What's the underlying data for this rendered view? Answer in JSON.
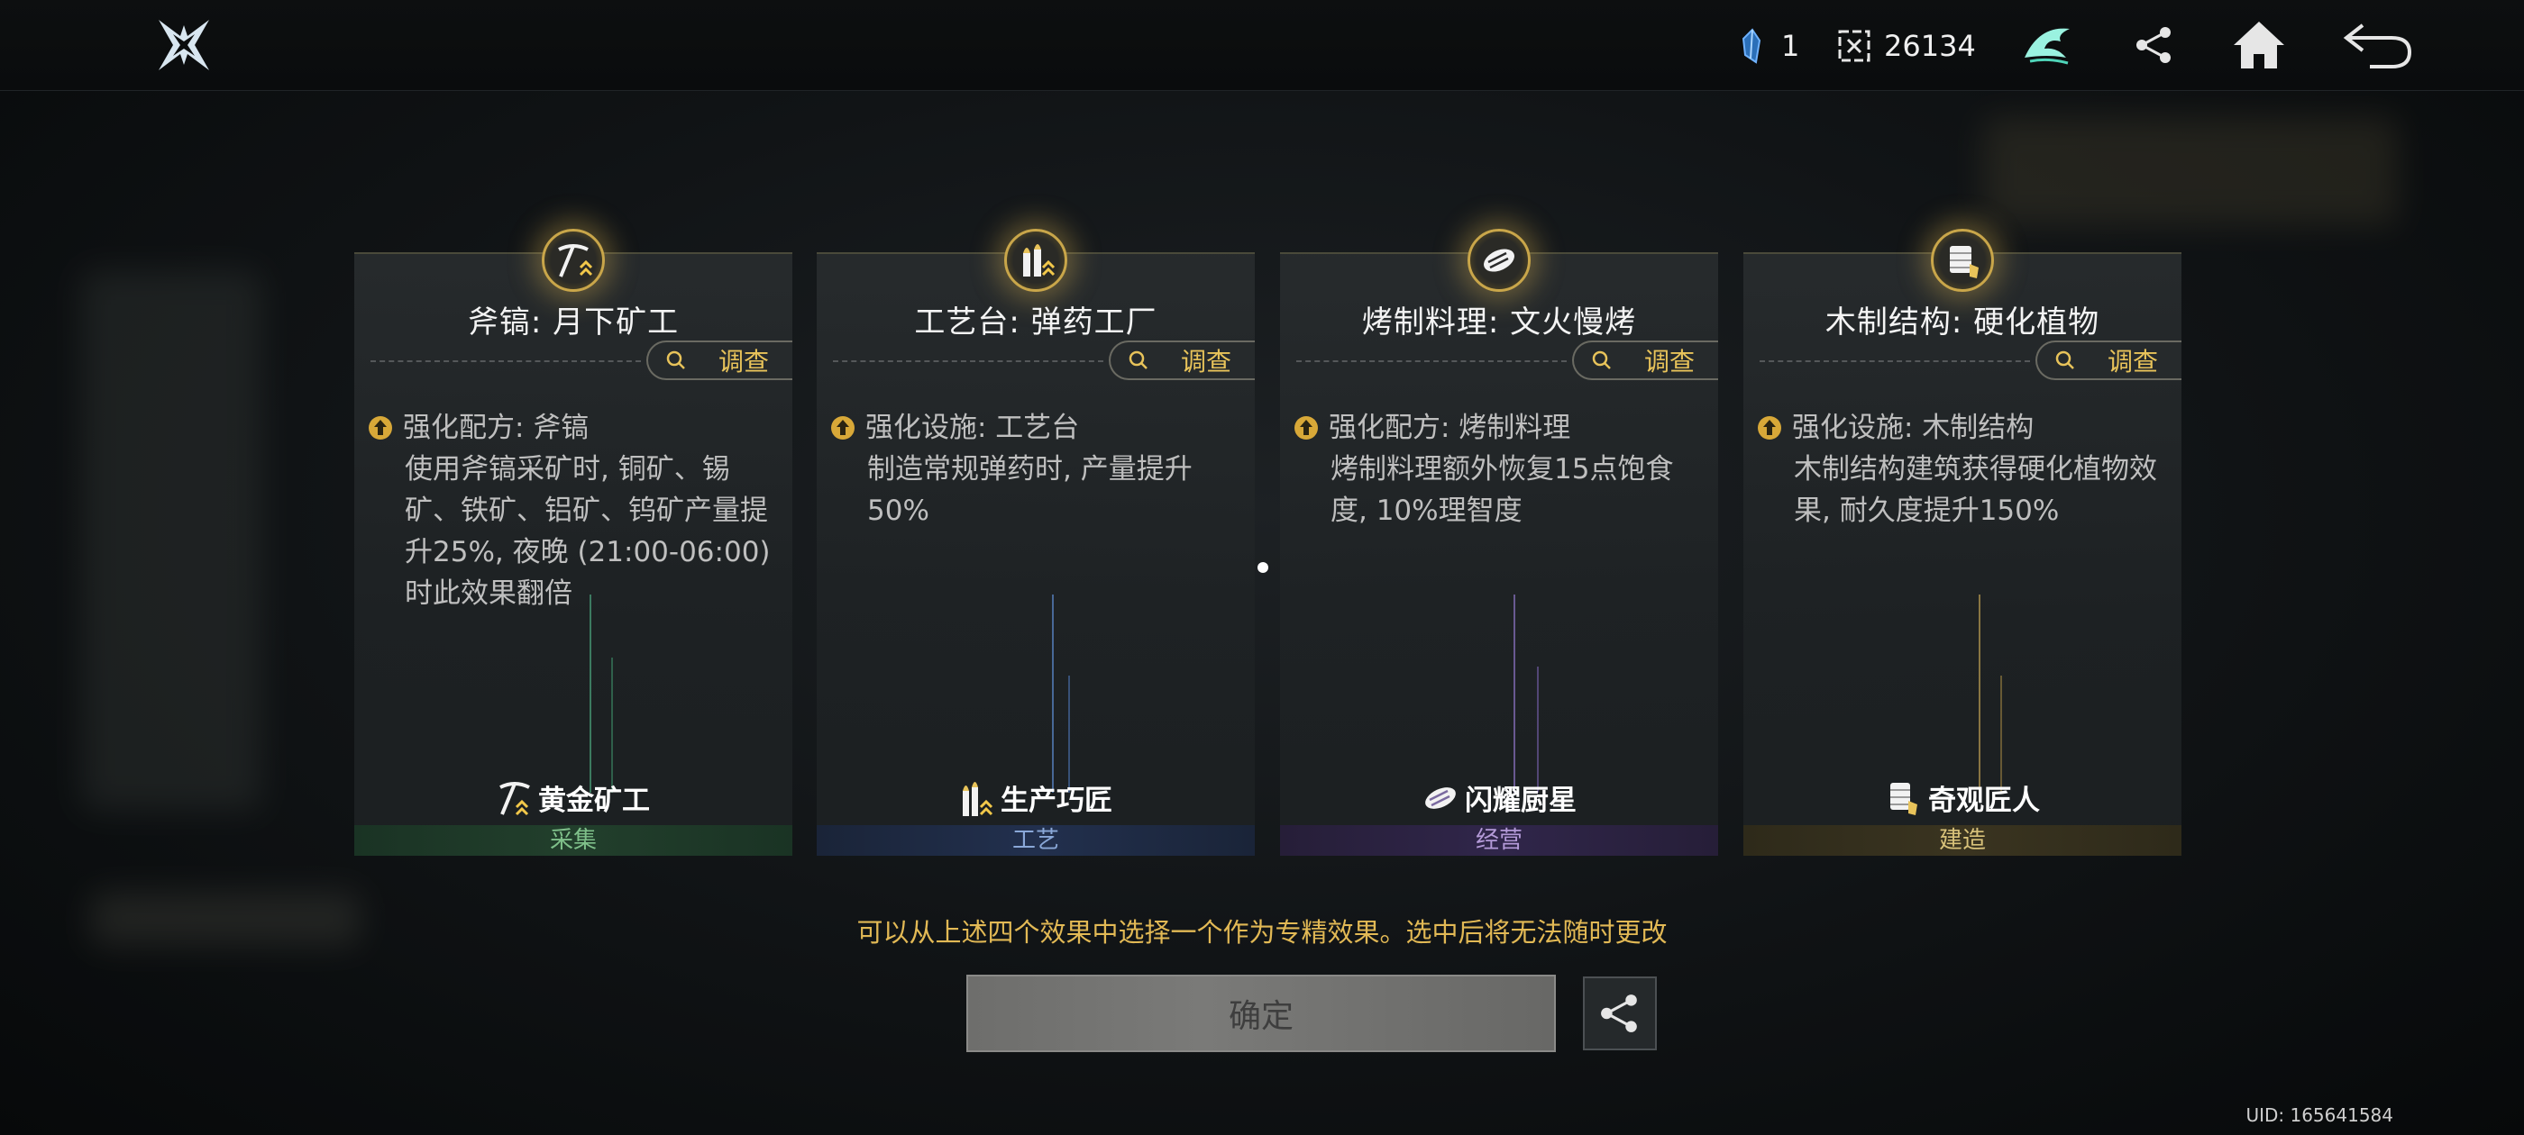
{
  "topbar": {
    "currency1_value": "1",
    "currency1_icon": "crystal-shard-icon",
    "currency2_value": "26134",
    "currency2_icon": "token-icon",
    "icons": [
      "guild-emblem-icon",
      "share-icon",
      "home-icon",
      "back-arrow-icon"
    ]
  },
  "cards": [
    {
      "title": "斧镐: 月下矿工",
      "medal_icon": "pickaxe-icon",
      "inspect_label": "调查",
      "effect_head": "强化配方: 斧镐",
      "effect_desc": "使用斧镐采矿时, 铜矿、锡矿、铁矿、铝矿、钨矿产量提升25%, 夜晚 (21:00-06:00) 时此效果翻倍",
      "role_label": "黄金矿工",
      "role_icon": "pickaxe-icon",
      "category": "采集",
      "category_color": "#7fc08a",
      "category_bg": "#1f3a2a"
    },
    {
      "title": "工艺台: 弹药工厂",
      "medal_icon": "ammo-icon",
      "inspect_label": "调查",
      "effect_head": "强化设施: 工艺台",
      "effect_desc": "制造常规弹药时, 产量提升50%",
      "role_label": "生产巧匠",
      "role_icon": "ammo-icon",
      "category": "工艺",
      "category_color": "#8aa8d8",
      "category_bg": "#1e2a44"
    },
    {
      "title": "烤制料理: 文火慢烤",
      "medal_icon": "grilled-meat-icon",
      "inspect_label": "调查",
      "effect_head": "强化配方: 烤制料理",
      "effect_desc": "烤制料理额外恢复15点饱食度, 10%理智度",
      "role_label": "闪耀厨星",
      "role_icon": "grilled-meat-icon",
      "category": "经营",
      "category_color": "#b49ad8",
      "category_bg": "#2e2444"
    },
    {
      "title": "木制结构: 硬化植物",
      "medal_icon": "wood-structure-icon",
      "inspect_label": "调查",
      "effect_head": "强化设施: 木制结构",
      "effect_desc": "木制结构建筑获得硬化植物效果, 耐久度提升150%",
      "role_label": "奇观匠人",
      "role_icon": "wood-structure-icon",
      "category": "建造",
      "category_color": "#d8c27a",
      "category_bg": "#3a3320"
    }
  ],
  "hint_text": "可以从上述四个效果中选择一个作为专精效果。选中后将无法随时更改",
  "confirm_label": "确定",
  "uid_text": "UID: 165641584"
}
